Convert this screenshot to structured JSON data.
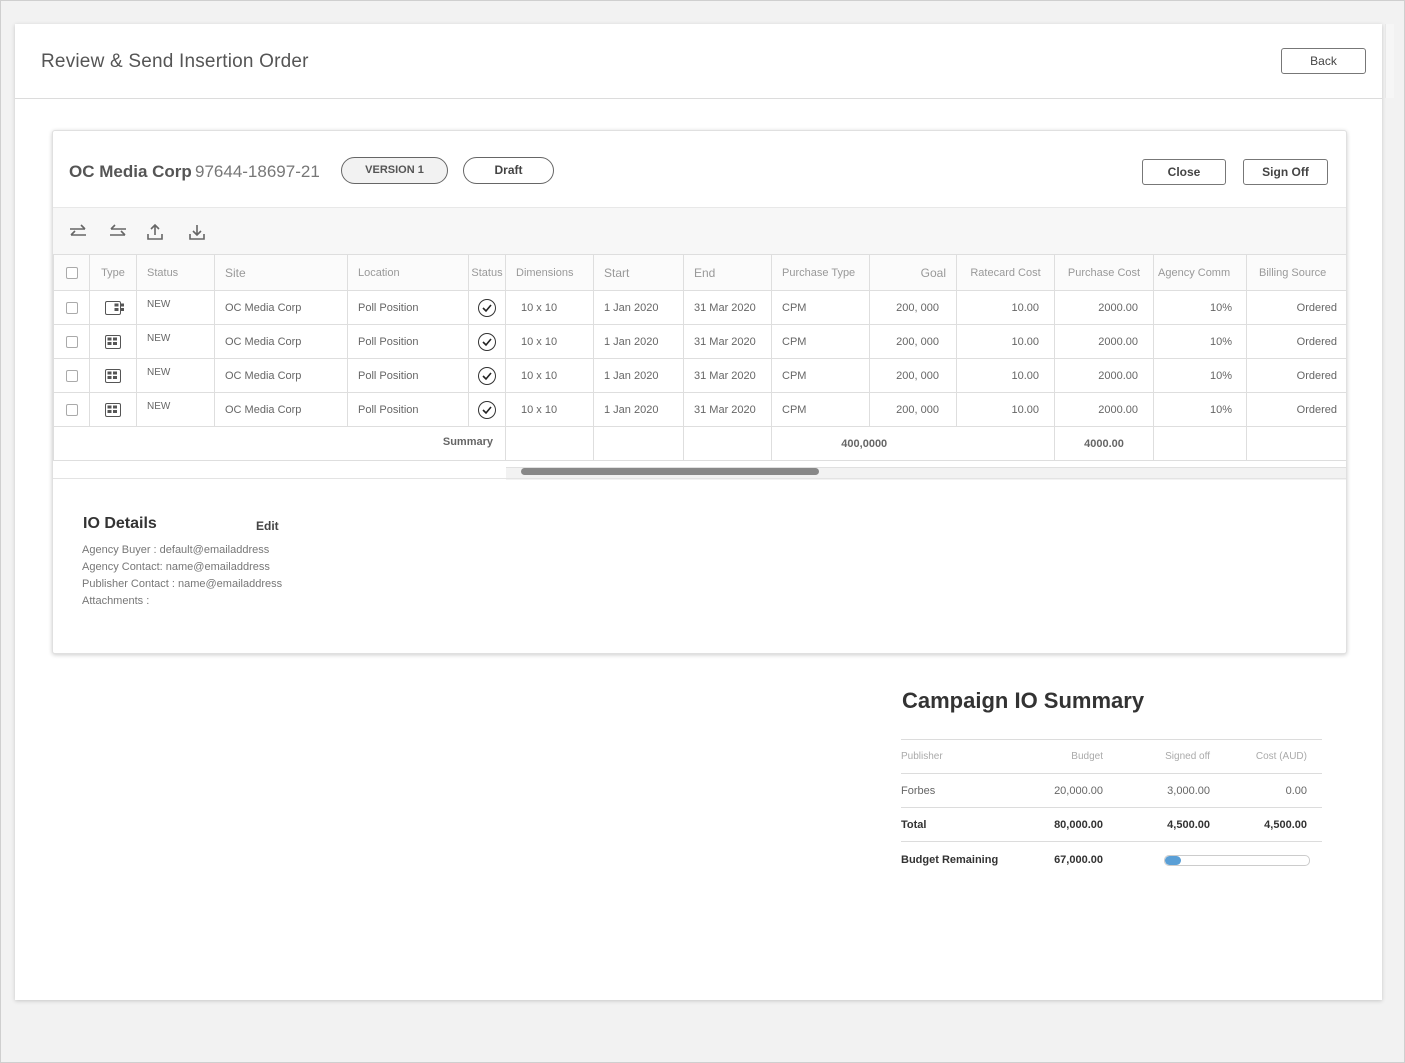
{
  "header": {
    "title": "Review & Send Insertion Order",
    "back_label": "Back"
  },
  "order": {
    "publisher": "OC Media Corp",
    "io_number": "97644-18697-21",
    "version_label": "VERSION 1",
    "status_label": "Draft",
    "close_label": "Close",
    "signoff_label": "Sign Off"
  },
  "toolbar": {
    "icons": [
      "swap-right-icon",
      "swap-left-icon",
      "upload-icon",
      "download-icon"
    ]
  },
  "table": {
    "headers": [
      "Type",
      "Status",
      "Site",
      "Location",
      "Status",
      "Dimensions",
      "Start",
      "End",
      "Purchase Type",
      "Goal",
      "Ratecard Cost",
      "Purchase Cost",
      "Agency Comm",
      "Billing Source"
    ],
    "rows": [
      {
        "status": "NEW",
        "site": "OC Media Corp",
        "location": "Poll Position",
        "dimensions": "10 x 10",
        "start": "1 Jan 2020",
        "end": "31 Mar 2020",
        "purchase_type": "CPM",
        "goal": "200, 000",
        "ratecard": "10.00",
        "purchase_cost": "2000.00",
        "agency_comm": "10%",
        "billing": "Ordered"
      },
      {
        "status": "NEW",
        "site": "OC Media Corp",
        "location": "Poll Position",
        "dimensions": "10 x 10",
        "start": "1 Jan 2020",
        "end": "31 Mar 2020",
        "purchase_type": "CPM",
        "goal": "200, 000",
        "ratecard": "10.00",
        "purchase_cost": "2000.00",
        "agency_comm": "10%",
        "billing": "Ordered"
      },
      {
        "status": "NEW",
        "site": "OC Media Corp",
        "location": "Poll Position",
        "dimensions": "10 x 10",
        "start": "1 Jan 2020",
        "end": "31 Mar 2020",
        "purchase_type": "CPM",
        "goal": "200, 000",
        "ratecard": "10.00",
        "purchase_cost": "2000.00",
        "agency_comm": "10%",
        "billing": "Ordered"
      },
      {
        "status": "NEW",
        "site": "OC Media Corp",
        "location": "Poll Position",
        "dimensions": "10 x 10",
        "start": "1 Jan 2020",
        "end": "31 Mar 2020",
        "purchase_type": "CPM",
        "goal": "200, 000",
        "ratecard": "10.00",
        "purchase_cost": "2000.00",
        "agency_comm": "10%",
        "billing": "Ordered"
      }
    ],
    "summary": {
      "label": "Summary",
      "goal_total": "400,0000",
      "purchase_total": "4000.00"
    }
  },
  "io_details": {
    "title": "IO Details",
    "edit_label": "Edit",
    "lines": [
      "Agency Buyer : default@emailaddress",
      "Agency Contact: name@emailaddress",
      "Publisher Contact : name@emailaddress",
      "Attachments :"
    ]
  },
  "campaign_summary": {
    "title": "Campaign IO Summary",
    "headers": [
      "Publisher",
      "Budget",
      "Signed off",
      "Cost (AUD)"
    ],
    "rows": [
      {
        "publisher": "Forbes",
        "budget": "20,000.00",
        "signed_off": "3,000.00",
        "cost": "0.00"
      }
    ],
    "total": {
      "label": "Total",
      "budget": "80,000.00",
      "signed_off": "4,500.00",
      "cost": "4,500.00"
    },
    "remaining": {
      "label": "Budget Remaining",
      "value": "67,000.00",
      "progress_fraction": 0.11,
      "progress_color": "#5a9fd6"
    }
  }
}
